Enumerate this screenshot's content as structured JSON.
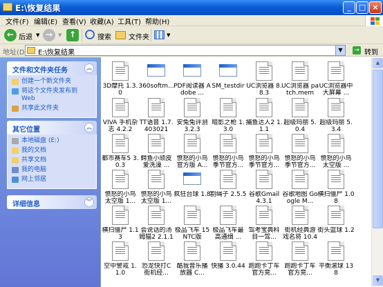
{
  "window": {
    "title": "E:\\恢复结果",
    "minimize": "_",
    "maximize": "□",
    "close": "×"
  },
  "menu": [
    "文件(F)",
    "编辑(E)",
    "查看(V)",
    "收藏(A)",
    "工具(T)",
    "帮助(H)"
  ],
  "toolbar": {
    "back": "后退",
    "search": "搜索",
    "folders": "文件夹"
  },
  "address": {
    "label": "地址(D)",
    "value": "E:\\恢复结果",
    "go": "转到"
  },
  "tasks": {
    "title": "文件和文件夹任务",
    "items": [
      "创建一个新文件夹",
      "将这个文件夹发布到 Web",
      "共享此文件夹"
    ]
  },
  "places": {
    "title": "其它位置",
    "items": [
      "本地磁盘 (E:)",
      "我的文档",
      "共享文档",
      "我的电脑",
      "网上邻居"
    ]
  },
  "details": {
    "title": "详细信息"
  },
  "files": [
    [
      "3D摩托 1.3.0",
      "360softm...",
      "PDF阅读器 Adobe ...",
      "SM_testdir",
      "UC浏览器 8.8.3",
      "UC浏览器 patch.mem",
      "UC浏览器中 大屏幕 ..."
    ],
    [
      "VIVA 手机杂 志 4.2.2",
      "TT语音 1.7.403021",
      "安兔兔评测 3.2.3",
      "暗影之枪 1.3.0",
      "捕鱼达人2 1.1.1",
      "超级玛丽 5.0.4",
      "超级玛丽 5.3.4"
    ],
    [
      "都市赛车5 3.0.3",
      "鳄鱼小顽皮 爱洗澡 ...",
      "愤怒的小鸟 官方版 A...",
      "愤怒的小鸟 季节官方...",
      "愤怒的小鸟 季节官方...",
      "愤怒的小鸟 季节官方...",
      "愤怒的小鸟 太空版 ..."
    ],
    [
      "愤怒的小鸟 太空版 1...",
      "愤怒的小鸟 太空版 1...",
      "疯狂台球 1.8",
      "割绳子 2.5.5",
      "谷歌Gmail 4.3.1",
      "谷歌地图 Google M...",
      "横扫僵尸 1.08"
    ],
    [
      "横扫僵尸 1.13",
      "会说话的汤 姆猫2 2.1.1",
      "极品飞车 15NTC版",
      "极品飞车最 高通缉 ...",
      "驾考宝典科 目一驾...",
      "街机经典游 戏名将 10.4",
      "街头篮球 1.2"
    ],
    [
      "空中警戒 1.1.0",
      "恐龙快打C 街机经...",
      "酷我音乐播 放器 C...",
      "快播 3.0.44",
      "跑跑卡丁车 官方竞...",
      "跑跑卡丁车 官方竞...",
      "平衡滚球 138"
    ]
  ]
}
